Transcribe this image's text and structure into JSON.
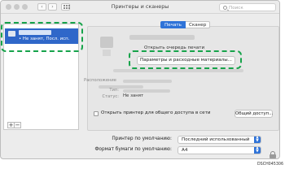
{
  "window": {
    "title": "Принтеры и сканеры"
  },
  "search": {
    "placeholder": "Поиск"
  },
  "sidebar": {
    "printer_status": "• Не занят, Посл. исп.",
    "add_label": "+",
    "remove_label": "−"
  },
  "tabs": [
    {
      "label": "Печать",
      "active": true
    },
    {
      "label": "Сканер",
      "active": false
    }
  ],
  "details": {
    "queue_button_label": "Открыть очередь печати",
    "options_button_label": "Параметры и расходные материалы...",
    "location_label": "Расположение",
    "type_label": "Тип:",
    "status_label": "Статус:",
    "status_value": "Не занят"
  },
  "sharing": {
    "label": "Открыть принтер для общего доступа в сети",
    "button_label": "Общий доступ..."
  },
  "defaults": {
    "printer_label": "Принтер по умолчанию:",
    "printer_value": "Последний использованный",
    "paper_label": "Формат бумаги по умолчанию:",
    "paper_value": "A4"
  },
  "figure_code": "DSCH045306",
  "colors": {
    "selection_blue": "#2f67c9",
    "accent_blue": "#2f73d8",
    "callout_green": "#16a34a"
  }
}
